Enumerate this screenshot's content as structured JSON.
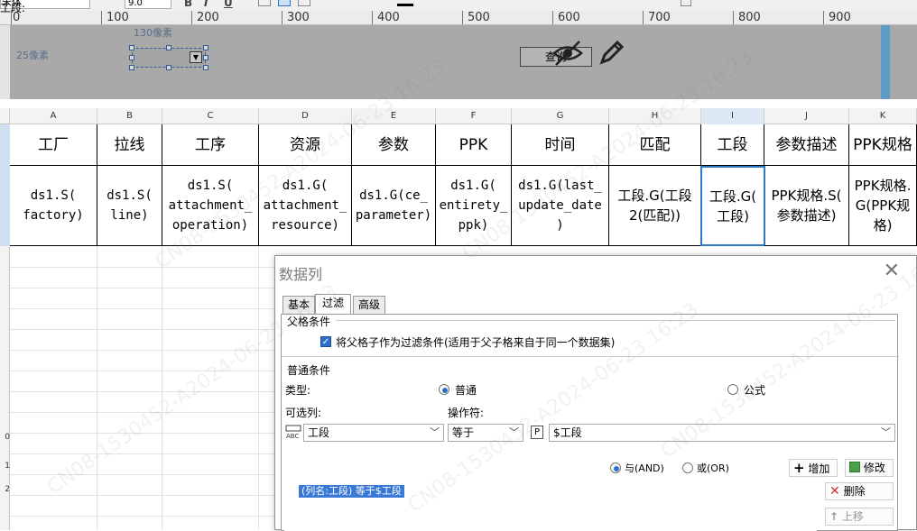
{
  "toolbar": {
    "font_name": "宋体",
    "font_size": "9.0",
    "bold": "B",
    "italic": "I",
    "underline": "U"
  },
  "ruler": {
    "ticks": [
      "0",
      "100",
      "200",
      "300",
      "400",
      "500",
      "600",
      "700",
      "800",
      "900"
    ]
  },
  "form_design": {
    "width_note": "130像素",
    "height_note": "25像素",
    "label_text": "工段:",
    "query_button": "查询"
  },
  "sheet": {
    "column_letters": [
      "A",
      "B",
      "C",
      "D",
      "E",
      "F",
      "G",
      "H",
      "I",
      "J",
      "K"
    ],
    "selected_column": "I",
    "row_numbers": [
      "0",
      "1",
      "2"
    ],
    "header_cells": [
      "工厂",
      "拉线",
      "工序",
      "资源",
      "参数",
      "PPK",
      "时间",
      "匹配",
      "工段",
      "参数描述",
      "PPK规格"
    ],
    "data_cells": [
      "ds1.S(\nfactory)",
      "ds1.S(\nline)",
      "ds1.S(\nattachment_\noperation)",
      "ds1.G(\nattachment_\nresource)",
      "ds1.G(ce_\nparameter)",
      "ds1.G(\nentirety_\nppk)",
      "ds1.G(last_\nupdate_date\n)",
      "工段.G(工段\n2(匹配))",
      "工段.G(\n工段)",
      "PPK规格.S(\n参数描述)",
      "PPK规格.\nG(PPK规\n格)"
    ]
  },
  "dialog": {
    "title": "数据列",
    "close_symbol": "✕",
    "tabs": [
      "基本",
      "过滤",
      "高级"
    ],
    "active_tab": "过滤",
    "parent_section": "父格条件",
    "parent_checkbox": "将父格子作为过滤条件(适用于父子格来自于同一个数据集)",
    "normal_section": "普通条件",
    "type_label": "类型:",
    "type_normal": "普通",
    "type_formula": "公式",
    "column_label": "可选列:",
    "column_value": "工段",
    "operator_label": "操作符:",
    "operator_value": "等于",
    "param_icon": "P",
    "value_field": "$工段",
    "and_label": "与(AND)",
    "or_label": "或(OR)",
    "add_button": "增加",
    "modify_button": "修改",
    "delete_button": "删除",
    "move_up_button": "上移",
    "condition_item": "(列名:工段) 等于$工段"
  },
  "watermark_text": "CN08-1530452-A2024-06-23 16:23",
  "colors": {
    "selection_blue": "#2f79c4",
    "checkbox_blue": "#2d70c7",
    "delete_red": "#d8302e",
    "form_grey": "#a9a9a9"
  }
}
